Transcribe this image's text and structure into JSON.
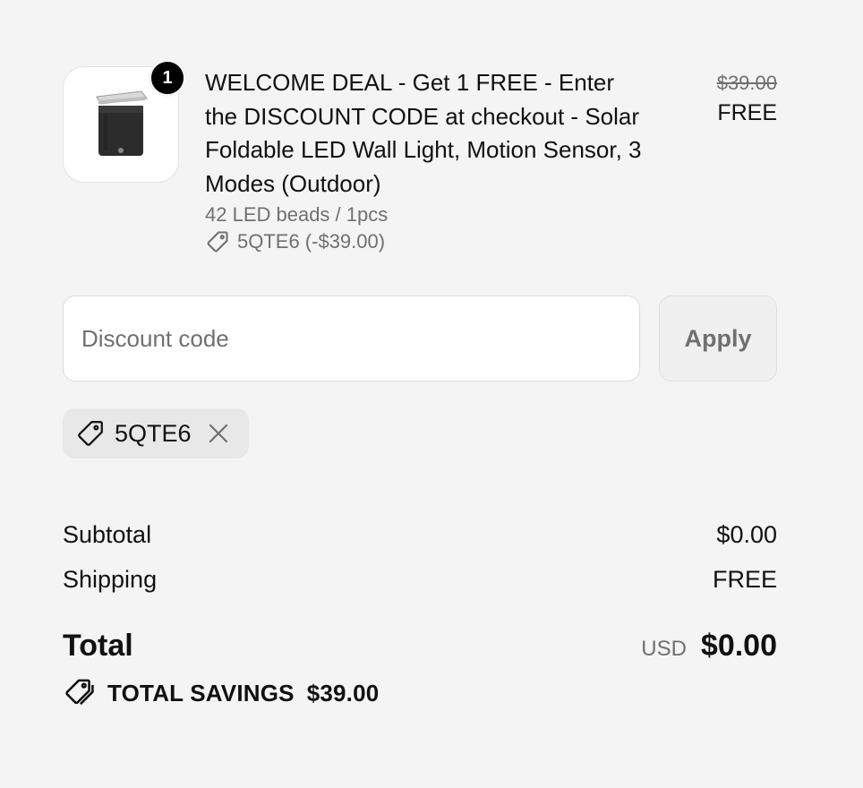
{
  "line_item": {
    "quantity": "1",
    "title": "WELCOME DEAL - Get 1 FREE - Enter the DISCOUNT CODE at checkout - Solar Foldable LED Wall Light, Motion Sensor, 3 Modes (Outdoor)",
    "variant": "42 LED beads / 1pcs",
    "discount_applied": "5QTE6 (-$39.00)",
    "price_original": "$39.00",
    "price_final": "FREE",
    "thumbnail_icon": "solar-wall-light-product-image"
  },
  "discount_form": {
    "placeholder": "Discount code",
    "apply_label": "Apply"
  },
  "applied_codes": [
    {
      "code": "5QTE6",
      "icon": "tag-icon",
      "remove_icon": "close-icon"
    }
  ],
  "totals": {
    "subtotal_label": "Subtotal",
    "subtotal_value": "$0.00",
    "shipping_label": "Shipping",
    "shipping_value": "FREE",
    "total_label": "Total",
    "currency": "USD",
    "total_value": "$0.00",
    "savings_label": "TOTAL SAVINGS",
    "savings_value": "$39.00"
  },
  "colors": {
    "background": "#f4f4f4",
    "text": "#111111",
    "muted_text": "#707070",
    "badge": "#000000"
  }
}
